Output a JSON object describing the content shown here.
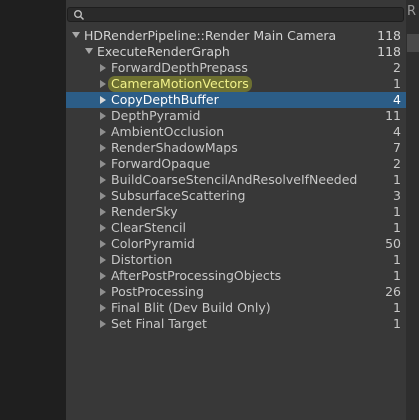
{
  "search": {
    "placeholder": ""
  },
  "side_tab": {
    "label": "R"
  },
  "tree": {
    "root": {
      "label": "HDRenderPipeline::Render Main Camera",
      "count": "118"
    },
    "graph": {
      "label": "ExecuteRenderGraph",
      "count": "118"
    },
    "items": [
      {
        "label": "ForwardDepthPrepass",
        "count": "2"
      },
      {
        "label": "CameraMotionVectors",
        "count": "1",
        "highlighted": true
      },
      {
        "label": "CopyDepthBuffer",
        "count": "4",
        "selected": true
      },
      {
        "label": "DepthPyramid",
        "count": "11"
      },
      {
        "label": "AmbientOcclusion",
        "count": "4"
      },
      {
        "label": "RenderShadowMaps",
        "count": "7"
      },
      {
        "label": "ForwardOpaque",
        "count": "2"
      },
      {
        "label": "BuildCoarseStencilAndResolveIfNeeded",
        "count": "1"
      },
      {
        "label": "SubsurfaceScattering",
        "count": "3"
      },
      {
        "label": "RenderSky",
        "count": "1"
      },
      {
        "label": "ClearStencil",
        "count": "1"
      },
      {
        "label": "ColorPyramid",
        "count": "50"
      },
      {
        "label": "Distortion",
        "count": "1"
      },
      {
        "label": "AfterPostProcessingObjects",
        "count": "1"
      },
      {
        "label": "PostProcessing",
        "count": "26"
      },
      {
        "label": "Final Blit (Dev Build Only)",
        "count": "1"
      },
      {
        "label": "Set Final Target",
        "count": "1"
      }
    ]
  },
  "colors": {
    "selection": "#2c5d87",
    "highlight": "#c5cc28",
    "panel": "#383838"
  }
}
